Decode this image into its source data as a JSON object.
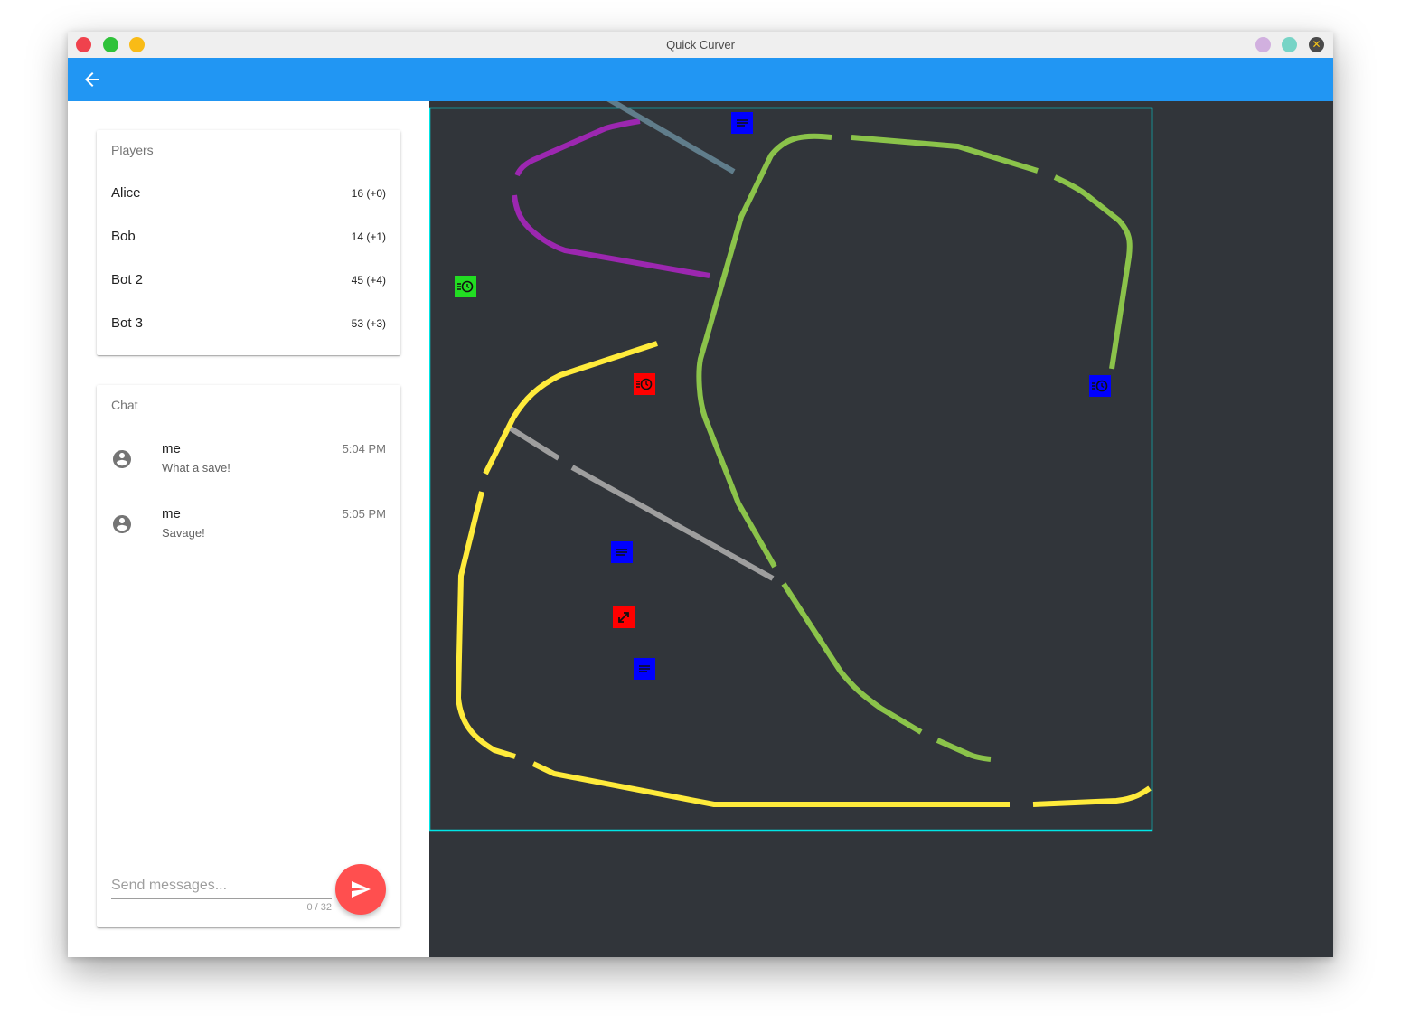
{
  "window": {
    "title": "Quick Curver"
  },
  "appbar": {
    "back_icon": "arrow-left-icon"
  },
  "players": {
    "title": "Players",
    "rows": [
      {
        "name": "Alice",
        "score": "16 (+0)"
      },
      {
        "name": "Bob",
        "score": "14 (+1)"
      },
      {
        "name": "Bot 2",
        "score": "45 (+4)"
      },
      {
        "name": "Bot 3",
        "score": "53 (+3)"
      }
    ]
  },
  "chat": {
    "title": "Chat",
    "messages": [
      {
        "author": "me",
        "time": "5:04 PM",
        "text": "What a save!"
      },
      {
        "author": "me",
        "time": "5:05 PM",
        "text": "Savage!"
      }
    ],
    "input": {
      "placeholder": "Send messages...",
      "value": "",
      "counter": "0 / 32"
    },
    "send_icon": "send-icon"
  },
  "game": {
    "board_border_color": "#00e5e5",
    "background_color": "#31353a",
    "trail_colors": {
      "green": "#8bc34a",
      "yellow": "#ffeb3b",
      "purple": "#9c27b0",
      "slate": "#607d8b",
      "gray": "#9e9e9e"
    },
    "powerups": [
      {
        "kind": "notes-icon",
        "color": "#0000ff"
      },
      {
        "kind": "slow-timer-icon",
        "color": "#22dd22"
      },
      {
        "kind": "slow-timer-icon",
        "color": "#ff0000"
      },
      {
        "kind": "slow-timer-icon",
        "color": "#0000ff"
      },
      {
        "kind": "notes-icon",
        "color": "#0000ff"
      },
      {
        "kind": "expand-icon",
        "color": "#ff0000"
      },
      {
        "kind": "notes-icon",
        "color": "#0000ff"
      }
    ]
  }
}
